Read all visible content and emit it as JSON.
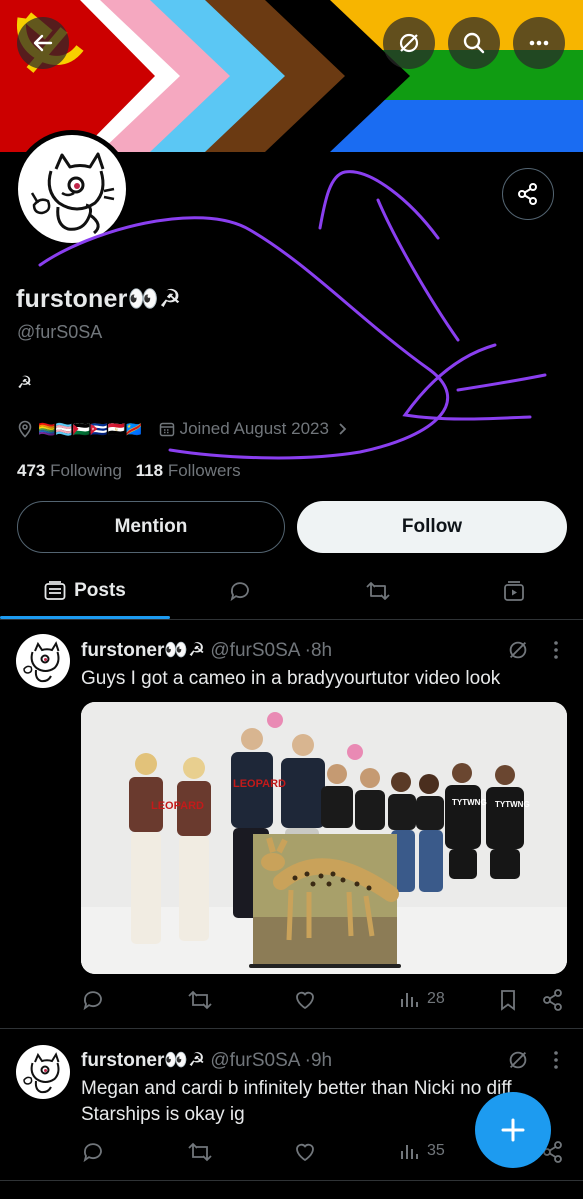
{
  "profile": {
    "display_name": "furstoner👀☭",
    "handle": "@furS0SA",
    "bio": "☭",
    "location_flags": "🏳️‍🌈🏳️‍⚧️🇵🇸🇨🇺🇪🇬🇨🇩",
    "joined": "Joined August 2023",
    "following_count": "473",
    "following_label": "Following",
    "followers_count": "118",
    "followers_label": "Followers"
  },
  "buttons": {
    "mention": "Mention",
    "follow": "Follow"
  },
  "tabs": [
    {
      "label": "Posts",
      "icon": "posts-icon",
      "active": true
    },
    {
      "label": "",
      "icon": "replies-icon"
    },
    {
      "label": "",
      "icon": "repost-icon"
    },
    {
      "label": "",
      "icon": "media-icon"
    }
  ],
  "posts": [
    {
      "name": "furstoner👀☭",
      "handle": "@furS0SA",
      "sep": "·",
      "time": "8h",
      "text": "Guys I got a cameo in a bradyyourtutor video look",
      "media_labels": [
        "LEOPARD",
        "LEOPARD",
        "TYTWNG",
        "TYTWNG"
      ],
      "views": "28"
    },
    {
      "name": "furstoner👀☭",
      "handle": "@furS0SA",
      "sep": "·",
      "time": "9h",
      "text_line1": "Megan and cardi b infinitely better than Nicki no diff",
      "text_line2": "Starships is okay ig",
      "views": "35"
    }
  ],
  "colors": {
    "accent": "#1d9bf0",
    "secondary_text": "#71767b",
    "doodle": "#8a3ff0"
  }
}
